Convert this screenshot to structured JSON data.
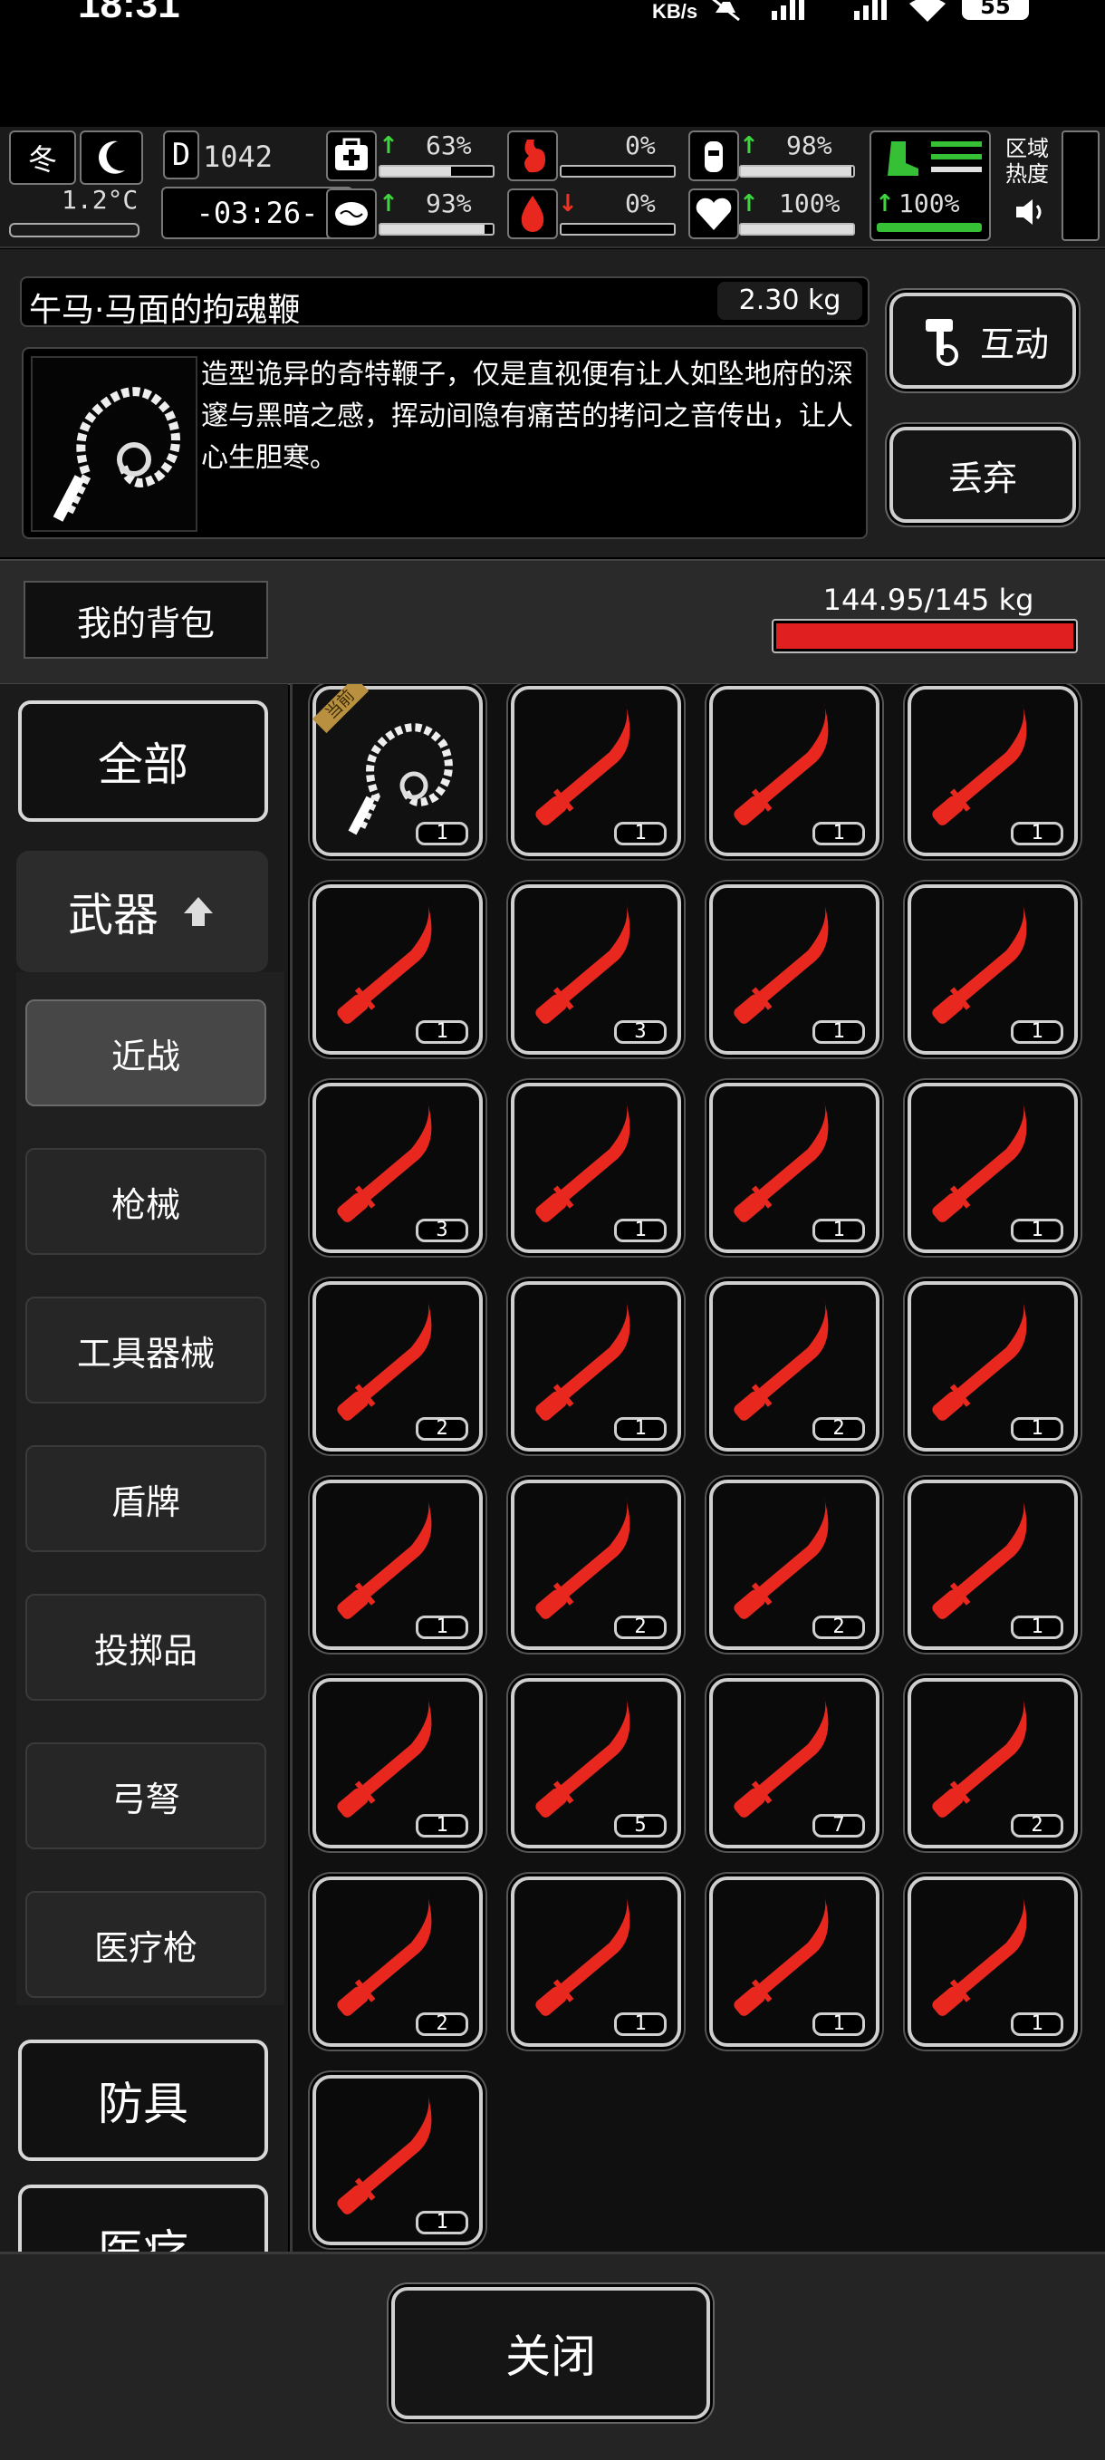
{
  "status_bar": {
    "time": "18:31",
    "net_speed": "KB/s",
    "battery": "55"
  },
  "hud": {
    "season": "冬",
    "temperature": "1.2°C",
    "day_label": "D",
    "day": "1042",
    "clock": "-03:26-",
    "stats": [
      {
        "name": "health",
        "value": "63%",
        "trend": "up"
      },
      {
        "name": "stomach",
        "value": "0%",
        "trend": "none"
      },
      {
        "name": "hydration",
        "value": "98%",
        "trend": "up"
      },
      {
        "name": "stamina",
        "value": "93%",
        "trend": "up"
      },
      {
        "name": "blood",
        "value": "0%",
        "trend": "down"
      },
      {
        "name": "heart",
        "value": "100%",
        "trend": "up"
      }
    ],
    "boot_value": "100%",
    "region_label": "区域\n热度"
  },
  "item": {
    "name": "午马·马面的拘魂鞭",
    "weight": "2.30 kg",
    "description": "造型诡异的奇特鞭子，仅是直视便有让人如坠地府的深邃与黑暗之感，挥动间隐有痛苦的拷问之音传出，让人心生胆寒。",
    "interact_label": "互动",
    "discard_label": "丢弃"
  },
  "backpack": {
    "title": "我的背包",
    "capacity": "144.95/145 kg",
    "fill_fraction": 0.9997
  },
  "sidebar": {
    "all": "全部",
    "weapons": "武器",
    "sub": [
      "近战",
      "枪械",
      "工具器械",
      "盾牌",
      "投掷品",
      "弓弩",
      "医疗枪"
    ],
    "armor": "防具",
    "medical": "医疗"
  },
  "grid": {
    "equipped_badge": "当前",
    "items": [
      {
        "icon": "whip-icon",
        "qty": "1"
      },
      {
        "icon": "knife-icon",
        "qty": "1"
      },
      {
        "icon": "knife-icon",
        "qty": "1"
      },
      {
        "icon": "knife-icon",
        "qty": "1"
      },
      {
        "icon": "knife-icon",
        "qty": "1"
      },
      {
        "icon": "knife-icon",
        "qty": "3"
      },
      {
        "icon": "knife-icon",
        "qty": "1"
      },
      {
        "icon": "knife-icon",
        "qty": "1"
      },
      {
        "icon": "knife-icon",
        "qty": "3"
      },
      {
        "icon": "knife-icon",
        "qty": "1"
      },
      {
        "icon": "knife-icon",
        "qty": "1"
      },
      {
        "icon": "knife-icon",
        "qty": "1"
      },
      {
        "icon": "knife-icon",
        "qty": "2"
      },
      {
        "icon": "knife-icon",
        "qty": "1"
      },
      {
        "icon": "knife-icon",
        "qty": "2"
      },
      {
        "icon": "knife-icon",
        "qty": "1"
      },
      {
        "icon": "knife-icon",
        "qty": "1"
      },
      {
        "icon": "knife-icon",
        "qty": "2"
      },
      {
        "icon": "knife-icon",
        "qty": "2"
      },
      {
        "icon": "knife-icon",
        "qty": "1"
      },
      {
        "icon": "knife-icon",
        "qty": "1"
      },
      {
        "icon": "knife-icon",
        "qty": "5"
      },
      {
        "icon": "knife-icon",
        "qty": "7"
      },
      {
        "icon": "knife-icon",
        "qty": "2"
      },
      {
        "icon": "knife-icon",
        "qty": "2"
      },
      {
        "icon": "knife-icon",
        "qty": "1"
      },
      {
        "icon": "knife-icon",
        "qty": "1"
      },
      {
        "icon": "knife-icon",
        "qty": "1"
      },
      {
        "icon": "knife-icon",
        "qty": "1"
      }
    ]
  },
  "close_label": "关闭",
  "colors": {
    "knife": "#e8281e",
    "capacity_bar": "#e02020",
    "stamina_green": "#35c035"
  }
}
